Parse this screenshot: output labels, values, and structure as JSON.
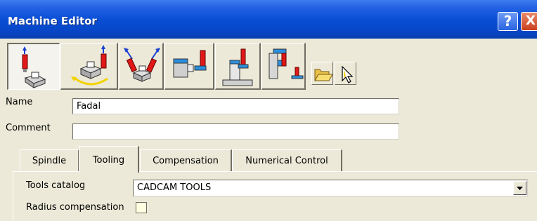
{
  "window": {
    "title": "Machine Editor",
    "help_glyph": "?",
    "close_glyph": "X"
  },
  "toolbar": {
    "buttons": [
      {
        "icon": "machine-3axis-icon",
        "pressed": true
      },
      {
        "icon": "machine-rotary-table-icon",
        "pressed": false
      },
      {
        "icon": "machine-5axis-icon",
        "pressed": false
      },
      {
        "icon": "machine-horizontal-spindle-icon",
        "pressed": false
      },
      {
        "icon": "machine-vertical-spindle-icon",
        "pressed": false
      },
      {
        "icon": "machine-turret-icon",
        "pressed": false
      },
      {
        "icon": "open-folder-icon",
        "pressed": false
      },
      {
        "icon": "select-pointer-icon",
        "pressed": false
      }
    ]
  },
  "form": {
    "name_label": "Name",
    "name_value": "Fadal",
    "comment_label": "Comment",
    "comment_value": ""
  },
  "tabs": [
    {
      "label": "Spindle",
      "active": false
    },
    {
      "label": "Tooling",
      "active": true
    },
    {
      "label": "Compensation",
      "active": false
    },
    {
      "label": "Numerical Control",
      "active": false
    }
  ],
  "tooling": {
    "tools_catalog_label": "Tools catalog",
    "tools_catalog_value": "CADCAM TOOLS",
    "radius_compensation_label": "Radius compensation",
    "radius_compensation_checked": false
  },
  "colors": {
    "titlebar": "#0a4fd6",
    "dialog_bg": "#ece9d8",
    "icon_red": "#e01818",
    "icon_blue": "#1a3fd0",
    "icon_yellow": "#f2d200"
  }
}
